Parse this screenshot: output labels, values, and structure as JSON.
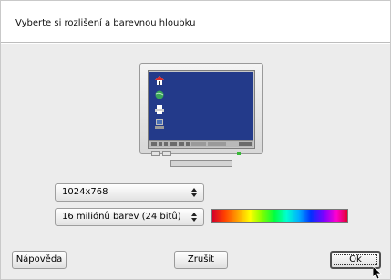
{
  "header": {
    "title": "Vyberte si rozlišení a barevnou hloubku"
  },
  "resolution": {
    "selected": "1024x768"
  },
  "color_depth": {
    "selected": "16 miliónů barev (24 bitů)"
  },
  "buttons": {
    "help": "Nápověda",
    "cancel": "Zrušit",
    "ok": "Ok"
  },
  "icons": {
    "monitor": "monitor-preview-icon",
    "home": "home-icon",
    "globe": "globe-icon",
    "printer": "printer-icon",
    "computer": "computer-icon",
    "cursor": "mouse-pointer-icon"
  },
  "colors": {
    "screen": "#233a8a",
    "body_bg": "#ececec",
    "header_bg": "#ffffff"
  }
}
